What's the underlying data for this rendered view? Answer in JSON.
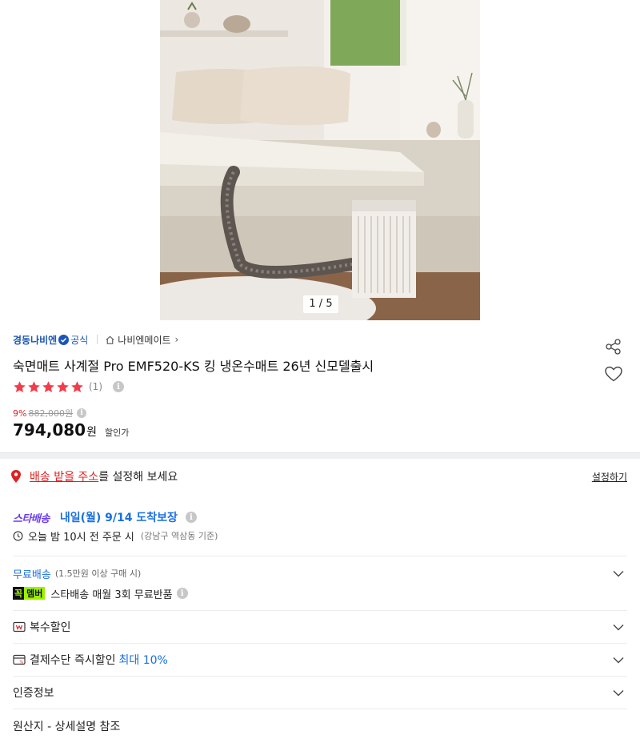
{
  "gallery": {
    "counter": "1 / 5"
  },
  "seller": {
    "brand": "경동나비엔",
    "official_label": "공식",
    "shop_link": "나비엔메이트"
  },
  "product": {
    "title": "숙면매트 사계절 Pro EMF520-KS 킹 냉온수매트 26년 신모델출시",
    "rating": 5,
    "review_count": "(1)",
    "discount_pct": "9%",
    "original_price": "882,000원",
    "price": "794,080",
    "currency": "원",
    "price_label": "할인가"
  },
  "address": {
    "link_text": "배송 받을 주소",
    "rest_text": "를 설정해 보세요",
    "setup_label": "설정하기"
  },
  "delivery": {
    "star_logo": "스타배송",
    "arrival": "내일(월) 9/14 도착보장",
    "order_deadline": "오늘 밤 10시 전 주문 시",
    "order_region": "(강남구 역삼동 기준)",
    "free_label": "무료배송",
    "free_condition": "(1.5만원 이상 구매 시)",
    "member_badge_left": "꼭",
    "member_badge_right": "멤버",
    "member_benefit": "스타배송 매월 3회 무료반품"
  },
  "sections": {
    "multi_discount": "복수할인",
    "payment_prefix": "결제수단 즉시할인",
    "payment_highlight": "최대 10%",
    "certification": "인증정보",
    "origin": "원산지 - 상세설명 참조"
  },
  "colors": {
    "accent_red": "#e02020",
    "link_blue": "#1a6fe0",
    "brand_blue": "#1a55b8",
    "star_purple": "#6a3df0",
    "member_green": "#9cf000"
  },
  "icons": [
    "share-icon",
    "heart-icon",
    "location-pin-icon",
    "clock-icon",
    "info-icon",
    "chevron-down-icon",
    "coupon-icon",
    "card-icon",
    "home-icon",
    "verified-icon",
    "star-icon"
  ]
}
